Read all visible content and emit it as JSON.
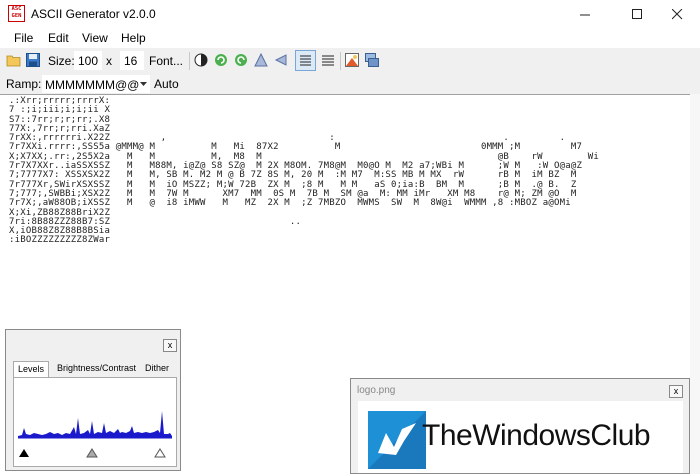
{
  "window": {
    "title": "ASCII Generator v2.0.0",
    "icon_text": "ASC\nGEN",
    "min_glyph": "—",
    "max_glyph": "☐",
    "close_glyph": "✕"
  },
  "menu": {
    "items": [
      "File",
      "Edit",
      "View",
      "Help"
    ]
  },
  "toolbar": {
    "size_label": "Size:",
    "width": "100",
    "x_label": "x",
    "height": "16",
    "font_button": "Font..."
  },
  "ramp": {
    "label": "Ramp:",
    "value": "MMMMMMM@@",
    "auto_label": "Auto"
  },
  "ascii_output": ".:Xrr;rrrrr;rrrrX:\n7 :;i;iii;i;i;ii X\nS7::7rr;r;r;rr;.X8\n77X:,7rr;r;rri.XaZ\n7rXX:,rrrrrri.X22Z         ,                             :                              .         .\n7r7XXi.rrrr:,SSS5a @MMM@ M          M   Mi  87X2          M                         0MMM ;M         M7\nX;X7XX;.rr:,2S5X2a   M   M          M,  M8  M                                          @B    rW        Wi\n7r7X7XXr..iaSSXSSZ   M   M88M, i@Z@ S8 SZ@  M 2X M8OM. 7M8@M  M0@O M  M2 a7;WBi M      ;W M   :W O@a@Z\n7;7777X7: XSSXSX2Z   M   M, SB M. M2 M @ B 7Z 8S M, 20 M  :M M7  M:SS MB M MX  rW      rB M  iM BZ  M\n7r777Xr,SWirXSXSSZ   M   M  iO MSZZ; M;W 72B  ZX M  ;8 M   M M   aS 0;ia:B  BM  M      ;B M  .@ B.  Z\n7;777;,SWBBi;XSX2Z   M   M  7W M      XM7  MM  0S M  7B M  SM @a  M: MM iMr   XM M8    r@ M; ZM @O  M\n7r7X;,aW88OB;iXSSZ   M   @  i8 iMWW   M   MZ  2X M  ;Z 7MBZO  MWMS  SW  M  8W@i  WMMM ,8 :MBOZ a@OMi\nX;Xi,ZB88Z88BriX2Z\n7ri:8B88ZZZ88B7:SZ                                ..\nX,iOB88Z8Z88B8BSia\n:iBOZZZZZZZZZ8ZWar",
  "levels_panel": {
    "tabs": [
      "Levels",
      "Brightness/Contrast",
      "Dither"
    ],
    "close_glyph": "x"
  },
  "logo_panel": {
    "title": "logo.png",
    "logo_text": "TheWindowsClub",
    "close_glyph": "x",
    "brand_color": "#1e90d6"
  }
}
